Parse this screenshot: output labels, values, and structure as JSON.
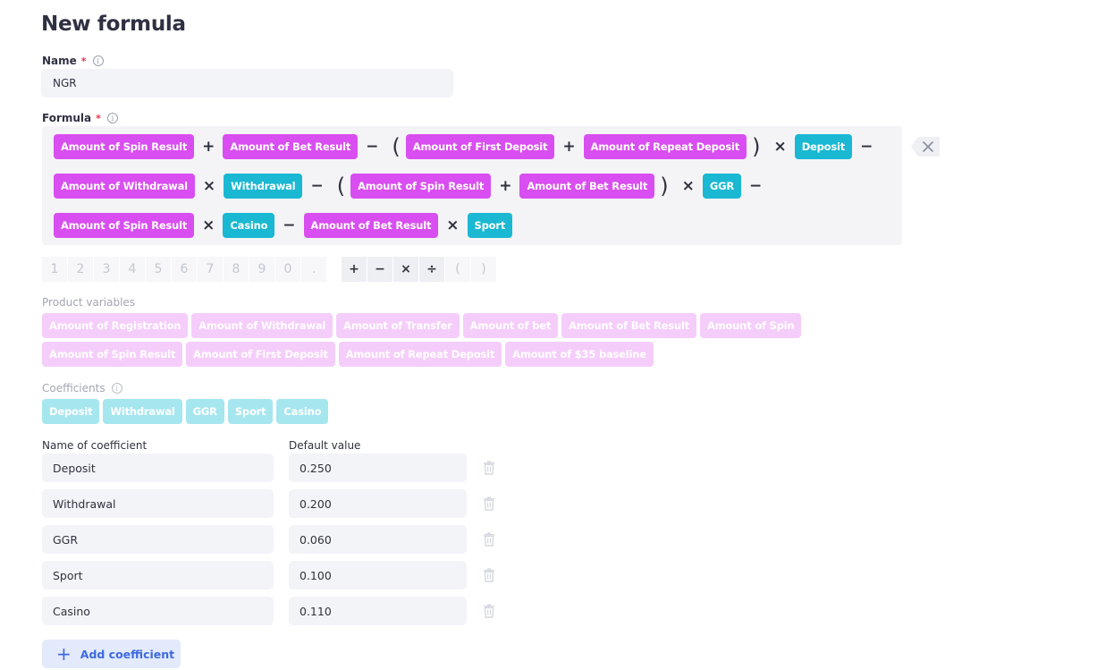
{
  "page": {
    "title": "New formula"
  },
  "name_field": {
    "label": "Name",
    "required_mark": "*",
    "value": "NGR"
  },
  "formula": {
    "label": "Formula",
    "required_mark": "*",
    "rows": [
      [
        {
          "type": "var",
          "text": "Amount of Spin Result"
        },
        {
          "type": "op",
          "text": "+"
        },
        {
          "type": "var",
          "text": "Amount of Bet Result"
        },
        {
          "type": "op",
          "text": "−"
        },
        {
          "type": "paren",
          "text": "("
        },
        {
          "type": "var",
          "text": "Amount of First Deposit"
        },
        {
          "type": "op",
          "text": "+"
        },
        {
          "type": "var",
          "text": "Amount of Repeat Deposit"
        },
        {
          "type": "paren",
          "text": ")"
        },
        {
          "type": "op",
          "text": "×"
        },
        {
          "type": "coef",
          "text": "Deposit"
        },
        {
          "type": "op",
          "text": "−"
        }
      ],
      [
        {
          "type": "var",
          "text": "Amount of Withdrawal"
        },
        {
          "type": "op",
          "text": "×"
        },
        {
          "type": "coef",
          "text": "Withdrawal"
        },
        {
          "type": "op",
          "text": "−"
        },
        {
          "type": "paren",
          "text": "("
        },
        {
          "type": "var",
          "text": "Amount of Spin Result"
        },
        {
          "type": "op",
          "text": "+"
        },
        {
          "type": "var",
          "text": "Amount of Bet Result"
        },
        {
          "type": "paren",
          "text": ")"
        },
        {
          "type": "op",
          "text": "×"
        },
        {
          "type": "coef",
          "text": "GGR"
        },
        {
          "type": "op",
          "text": "−"
        }
      ],
      [
        {
          "type": "var",
          "text": "Amount of Spin Result"
        },
        {
          "type": "op",
          "text": "×"
        },
        {
          "type": "coef",
          "text": "Casino"
        },
        {
          "type": "op",
          "text": "−"
        },
        {
          "type": "var",
          "text": "Amount of Bet Result"
        },
        {
          "type": "op",
          "text": "×"
        },
        {
          "type": "coef",
          "text": "Sport"
        }
      ]
    ],
    "backspace_icon": "backspace-icon"
  },
  "keypad": {
    "digits": [
      "1",
      "2",
      "3",
      "4",
      "5",
      "6",
      "7",
      "8",
      "9",
      "0",
      "."
    ],
    "operators": [
      {
        "text": "+",
        "enabled": true
      },
      {
        "text": "−",
        "enabled": true
      },
      {
        "text": "×",
        "enabled": true
      },
      {
        "text": "÷",
        "enabled": true
      },
      {
        "text": "(",
        "enabled": false
      },
      {
        "text": ")",
        "enabled": false
      }
    ]
  },
  "product_variables": {
    "label": "Product variables",
    "items": [
      "Amount of Registration",
      "Amount of Withdrawal",
      "Amount of Transfer",
      "Amount of bet",
      "Amount of Bet Result",
      "Amount of Spin",
      "Amount of Spin Result",
      "Amount of First Deposit",
      "Amount of Repeat Deposit",
      "Amount of $35 baseline"
    ]
  },
  "coefficients": {
    "label": "Coefficients",
    "items": [
      "Deposit",
      "Withdrawal",
      "GGR",
      "Sport",
      "Casino"
    ]
  },
  "coefficient_table": {
    "headers": {
      "name": "Name of coefficient",
      "value": "Default value"
    },
    "rows": [
      {
        "name": "Deposit",
        "value": "0.250"
      },
      {
        "name": "Withdrawal",
        "value": "0.200"
      },
      {
        "name": "GGR",
        "value": "0.060"
      },
      {
        "name": "Sport",
        "value": "0.100"
      },
      {
        "name": "Casino",
        "value": "0.110"
      }
    ],
    "add_button": "Add coefficient"
  },
  "colors": {
    "variable_chip": "#d94ef0",
    "coefficient_chip": "#1ab8d2",
    "variable_chip_muted": "#f5cdfa",
    "coefficient_chip_muted": "#a6e6ef",
    "accent_blue": "#3d6ae0",
    "required": "#e8334a"
  }
}
